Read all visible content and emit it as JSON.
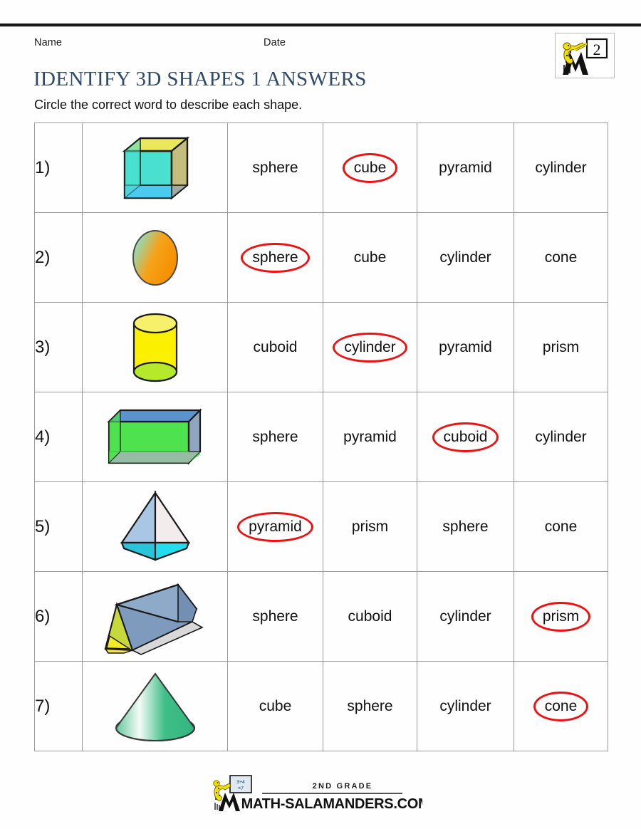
{
  "header": {
    "name_label": "Name",
    "date_label": "Date",
    "title": "IDENTIFY 3D SHAPES 1 ANSWERS",
    "subtitle": "Circle the correct word to describe each shape.",
    "grade_badge": "2"
  },
  "footer": {
    "grade_line": "2ND GRADE",
    "site_name": "MATH-SALAMANDERS.COM"
  },
  "colors": {
    "title_blue": "#2e4a6b",
    "answer_circle_red": "#ee1111",
    "table_border": "#9a9a9a"
  },
  "rows": [
    {
      "number": "1)",
      "shape": "cube",
      "options": [
        "sphere",
        "cube",
        "pyramid",
        "cylinder"
      ],
      "answer_index": 1
    },
    {
      "number": "2)",
      "shape": "sphere",
      "options": [
        "sphere",
        "cube",
        "cylinder",
        "cone"
      ],
      "answer_index": 0
    },
    {
      "number": "3)",
      "shape": "cylinder",
      "options": [
        "cuboid",
        "cylinder",
        "pyramid",
        "prism"
      ],
      "answer_index": 1
    },
    {
      "number": "4)",
      "shape": "cuboid",
      "options": [
        "sphere",
        "pyramid",
        "cuboid",
        "cylinder"
      ],
      "answer_index": 2
    },
    {
      "number": "5)",
      "shape": "pyramid",
      "options": [
        "pyramid",
        "prism",
        "sphere",
        "cone"
      ],
      "answer_index": 0
    },
    {
      "number": "6)",
      "shape": "prism",
      "options": [
        "sphere",
        "cuboid",
        "cylinder",
        "prism"
      ],
      "answer_index": 3
    },
    {
      "number": "7)",
      "shape": "cone",
      "options": [
        "cube",
        "sphere",
        "cylinder",
        "cone"
      ],
      "answer_index": 3
    }
  ]
}
